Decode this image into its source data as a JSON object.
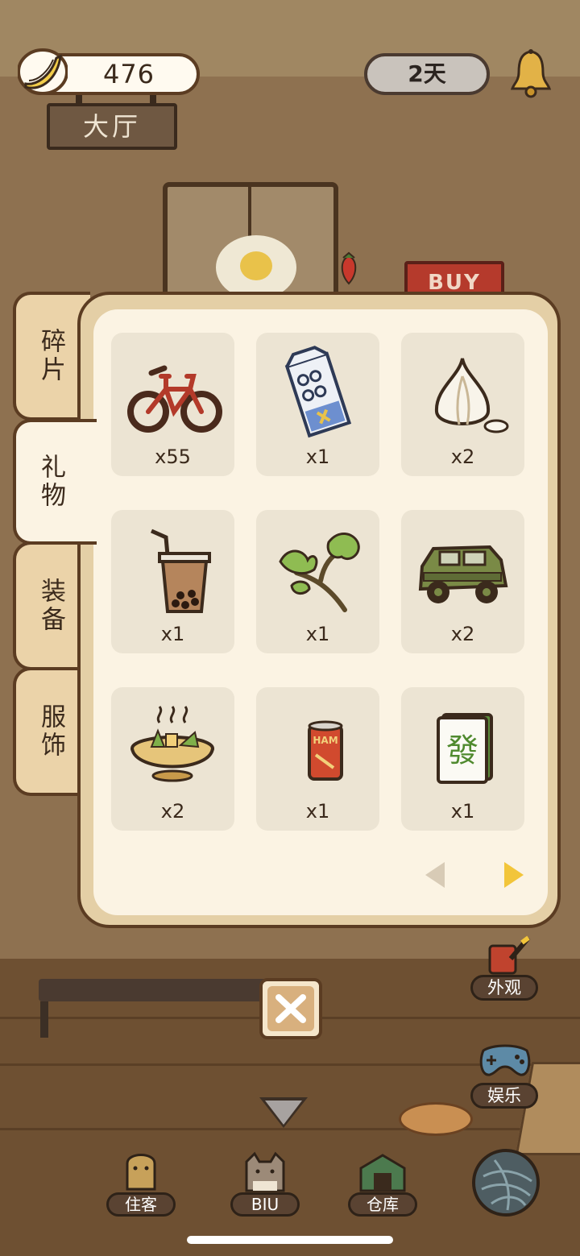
{
  "hud": {
    "banana_count": "476",
    "days": "2天",
    "room_name": "大厅",
    "buy_sign": "BUY"
  },
  "inventory": {
    "tabs": [
      {
        "label": "碎片",
        "active": false
      },
      {
        "label": "礼物",
        "active": true
      },
      {
        "label": "装备",
        "active": false
      },
      {
        "label": "服饰",
        "active": false
      }
    ],
    "items": [
      {
        "name": "bicycle",
        "count": "x55"
      },
      {
        "name": "milk-carton",
        "count": "x1"
      },
      {
        "name": "garlic",
        "count": "x2"
      },
      {
        "name": "bubble-tea",
        "count": "x1"
      },
      {
        "name": "celery",
        "count": "x1"
      },
      {
        "name": "jeep",
        "count": "x2"
      },
      {
        "name": "hotpot",
        "count": "x2"
      },
      {
        "name": "canned-food",
        "count": "x1"
      },
      {
        "name": "mahjong-tile",
        "count": "x1"
      }
    ],
    "mahjong_char": "發",
    "can_label": "HAM"
  },
  "side_buttons": {
    "appearance": "外观",
    "entertainment": "娱乐"
  },
  "bottom_nav": {
    "guests": "住客",
    "biu": "BIU",
    "warehouse": "仓库"
  },
  "colors": {
    "panel_border": "#5b3c22",
    "panel_bg": "#fbf3e3",
    "slot_bg": "#ece4d3",
    "next_arrow": "#f2c53a",
    "prev_arrow": "#d8cbb6"
  }
}
